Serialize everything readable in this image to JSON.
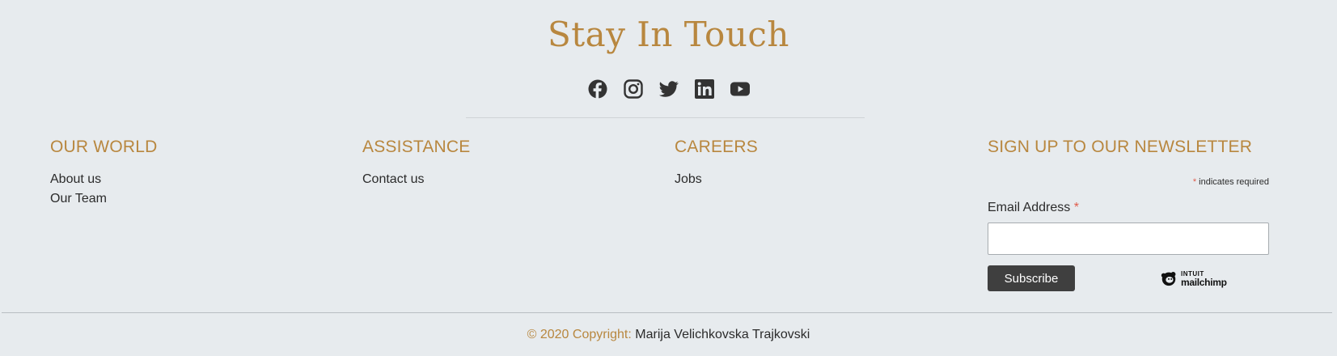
{
  "heading": "Stay In Touch",
  "socials": [
    {
      "icon": "facebook-icon"
    },
    {
      "icon": "instagram-icon"
    },
    {
      "icon": "twitter-icon"
    },
    {
      "icon": "linkedin-icon"
    },
    {
      "icon": "youtube-icon"
    }
  ],
  "columns": {
    "our_world": {
      "title": "OUR WORLD",
      "links": [
        "About us",
        "Our Team"
      ]
    },
    "assistance": {
      "title": "ASSISTANCE",
      "links": [
        "Contact us"
      ]
    },
    "careers": {
      "title": "CAREERS",
      "links": [
        "Jobs"
      ]
    }
  },
  "newsletter": {
    "title": "SIGN UP TO OUR NEWSLETTER",
    "required_star": "*",
    "required_note": "indicates required",
    "email_label": "Email Address",
    "email_value": "",
    "subscribe_label": "Subscribe",
    "badge_top": "INTUIT",
    "badge_bottom": "mailchimp"
  },
  "footer": {
    "copyright_prefix": "© 2020 Copyright:",
    "copyright_name": "Marija Velichkovska Trajkovski"
  },
  "colors": {
    "accent": "#b8873f",
    "background": "#e7ebee",
    "button": "#3f3f3f",
    "required": "#e05b4b"
  }
}
